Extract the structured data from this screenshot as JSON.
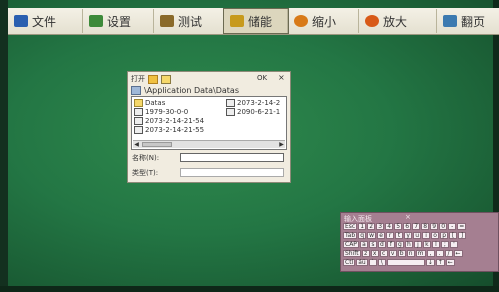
{
  "toolbar": {
    "buttons": [
      {
        "label": "文件",
        "icon": "monitor-icon",
        "color": "#2a5fb0"
      },
      {
        "label": "设置",
        "icon": "settings-icon",
        "color": "#3d8a3a"
      },
      {
        "label": "测试",
        "icon": "test-icon",
        "color": "#8a6a2a"
      },
      {
        "label": "储能",
        "icon": "storage-icon",
        "color": "#c79a1c"
      },
      {
        "label": "缩小",
        "icon": "minimize-icon",
        "color": "#d87a18"
      },
      {
        "label": "放大",
        "icon": "maximize-icon",
        "color": "#d85a18"
      },
      {
        "label": "翻页",
        "icon": "pageturn-icon",
        "color": "#3c7ab0"
      }
    ]
  },
  "dialog": {
    "title": "打开",
    "ok": "OK",
    "close": "×",
    "path": "\\Application Data\\Datas",
    "files": [
      "Datas",
      "2073-2-14-2",
      "1979-30-0-0",
      "2090-6-21-1",
      "2073-2-14-21-54",
      "2073-2-14-21-55"
    ],
    "name_label": "名称(N):",
    "type_label": "类型(T):"
  },
  "keyboard": {
    "title": "输入面板",
    "close": "×",
    "rows": [
      [
        "Esc",
        "1",
        "2",
        "3",
        "4",
        "5",
        "6",
        "7",
        "8",
        "9",
        "0",
        "-",
        "="
      ],
      [
        "Tab",
        "q",
        "w",
        "e",
        "r",
        "t",
        "y",
        "u",
        "i",
        "o",
        "p",
        "[",
        "]"
      ],
      [
        "CAP",
        "a",
        "s",
        "d",
        "f",
        "g",
        "h",
        "j",
        "k",
        "l",
        ";",
        "'"
      ],
      [
        "Shift",
        "z",
        "x",
        "c",
        "v",
        "b",
        "n",
        "m",
        ",",
        ".",
        "/",
        "←"
      ],
      [
        "Ctl",
        "áü",
        "`",
        "\\",
        "",
        "",
        "",
        "",
        "",
        "↓",
        "↑",
        "←"
      ]
    ]
  }
}
